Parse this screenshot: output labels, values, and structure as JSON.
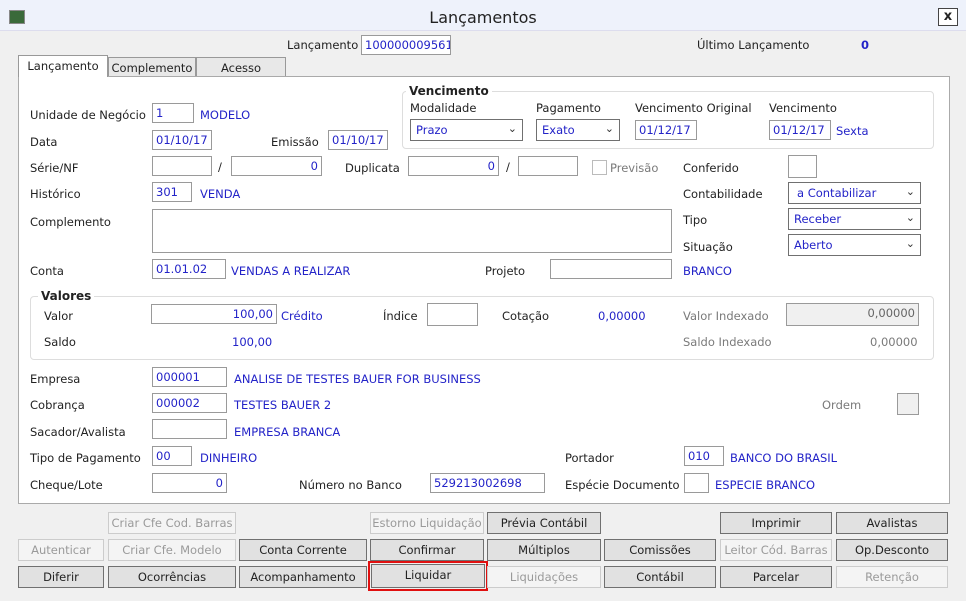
{
  "window": {
    "title": "Lançamentos",
    "close_label": "x"
  },
  "header": {
    "lancamento_label": "Lançamento",
    "lancamento_value": "100000009561",
    "ultimo_label": "Último Lançamento",
    "ultimo_value": "0"
  },
  "tabs": [
    {
      "label": "Lançamento",
      "active": true
    },
    {
      "label": "Complemento"
    },
    {
      "label": "Acesso"
    }
  ],
  "vencimento": {
    "title": "Vencimento",
    "modalidade_label": "Modalidade",
    "modalidade_value": "Prazo",
    "pagamento_label": "Pagamento",
    "pagamento_value": "Exato",
    "venc_original_label": "Vencimento Original",
    "venc_original_value": "01/12/17",
    "venc_label": "Vencimento",
    "venc_value": "01/12/17",
    "venc_dia": "Sexta"
  },
  "form": {
    "unidade_label": "Unidade de Negócio",
    "unidade_code": "1",
    "unidade_name": "MODELO",
    "data_label": "Data",
    "data_value": "01/10/17",
    "emissao_label": "Emissão",
    "emissao_value": "01/10/17",
    "serie_label": "Série/NF",
    "serie_value": "",
    "slash": "/",
    "nf_value": "0",
    "duplicata_label": "Duplicata",
    "duplicata_value": "0",
    "duplicata2_value": "",
    "previsao_label": "Previsão",
    "conferido_label": "Conferido",
    "historico_label": "Histórico",
    "historico_code": "301",
    "historico_name": "VENDA",
    "contabilidade_label": "Contabilidade",
    "contabilidade_value": "a Contabilizar",
    "complemento_label": "Complemento",
    "complemento_value": "",
    "tipo_label": "Tipo",
    "tipo_value": "Receber",
    "situacao_label": "Situação",
    "situacao_value": "Aberto",
    "conta_label": "Conta",
    "conta_code": "01.01.02",
    "conta_name": "VENDAS A REALIZAR",
    "projeto_label": "Projeto",
    "projeto_value": "",
    "projeto_name": "BRANCO"
  },
  "valores": {
    "title": "Valores",
    "valor_label": "Valor",
    "valor_value": "100,00",
    "valor_tipo": "Crédito",
    "indice_label": "Índice",
    "indice_value": "",
    "cotacao_label": "Cotação",
    "cotacao_value": "0,00000",
    "valor_indexado_label": "Valor Indexado",
    "valor_indexado_value": "0,00000",
    "saldo_label": "Saldo",
    "saldo_value": "100,00",
    "saldo_indexado_label": "Saldo Indexado",
    "saldo_indexado_value": "0,00000"
  },
  "dados": {
    "empresa_label": "Empresa",
    "empresa_code": "000001",
    "empresa_name": "ANALISE DE TESTES BAUER FOR BUSINESS",
    "cobranca_label": "Cobrança",
    "cobranca_code": "000002",
    "cobranca_name": "TESTES BAUER 2",
    "ordem_label": "Ordem",
    "sacador_label": "Sacador/Avalista",
    "sacador_code": "",
    "sacador_name": "EMPRESA BRANCA",
    "tipo_pag_label": "Tipo de Pagamento",
    "tipo_pag_code": "00",
    "tipo_pag_name": "DINHEIRO",
    "portador_label": "Portador",
    "portador_code": "010",
    "portador_name": "BANCO DO BRASIL",
    "cheque_label": "Cheque/Lote",
    "cheque_value": "0",
    "numero_banco_label": "Número no Banco",
    "numero_banco_value": "529213002698",
    "especie_label": "Espécie Documento",
    "especie_code": "",
    "especie_name": "ESPECIE BRANCO"
  },
  "buttons": {
    "criar_cfe_cod_barras": "Criar Cfe Cod. Barras",
    "estorno_liquidacao": "Estorno Liquidação",
    "previa_contabil": "Prévia Contábil",
    "imprimir": "Imprimir",
    "avalistas": "Avalistas",
    "autenticar": "Autenticar",
    "criar_cfe_modelo": "Criar Cfe. Modelo",
    "conta_corrente": "Conta Corrente",
    "confirmar": "Confirmar",
    "multiplos": "Múltiplos",
    "comissoes": "Comissões",
    "leitor_cod_barras": "Leitor Cód. Barras",
    "op_desconto": "Op.Desconto",
    "diferir": "Diferir",
    "ocorrencias": "Ocorrências",
    "acompanhamento": "Acompanhamento",
    "liquidar": "Liquidar",
    "liquidacoes": "Liquidações",
    "contabil": "Contábil",
    "parcelar": "Parcelar",
    "retencao": "Retenção"
  },
  "colors": {
    "value_text": "#2323c8",
    "highlight": "#e01010"
  }
}
